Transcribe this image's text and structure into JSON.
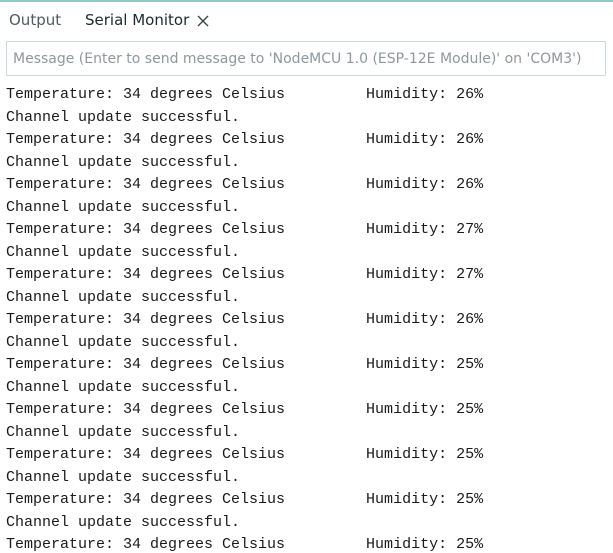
{
  "tabs": [
    {
      "label": "Output"
    },
    {
      "label": "Serial Monitor"
    }
  ],
  "message_input": {
    "value": "",
    "placeholder": "Message (Enter to send message to 'NodeMCU 1.0 (ESP-12E Module)' on 'COM3')"
  },
  "console": {
    "lines": [
      "Temperature: 34 degrees Celsius         Humidity: 26%",
      "Channel update successful.",
      "Temperature: 34 degrees Celsius         Humidity: 26%",
      "Channel update successful.",
      "Temperature: 34 degrees Celsius         Humidity: 26%",
      "Channel update successful.",
      "Temperature: 34 degrees Celsius         Humidity: 27%",
      "Channel update successful.",
      "Temperature: 34 degrees Celsius         Humidity: 27%",
      "Channel update successful.",
      "Temperature: 34 degrees Celsius         Humidity: 26%",
      "Channel update successful.",
      "Temperature: 34 degrees Celsius         Humidity: 25%",
      "Channel update successful.",
      "Temperature: 34 degrees Celsius         Humidity: 25%",
      "Channel update successful.",
      "Temperature: 34 degrees Celsius         Humidity: 25%",
      "Channel update successful.",
      "Temperature: 34 degrees Celsius         Humidity: 25%",
      "Channel update successful.",
      "Temperature: 34 degrees Celsius         Humidity: 25%"
    ]
  },
  "icons": {
    "close": "close-icon"
  },
  "colors": {
    "accent_rule": "#8fc9c7",
    "input_border": "#cdd8dc",
    "text": "#1a1a1a"
  }
}
